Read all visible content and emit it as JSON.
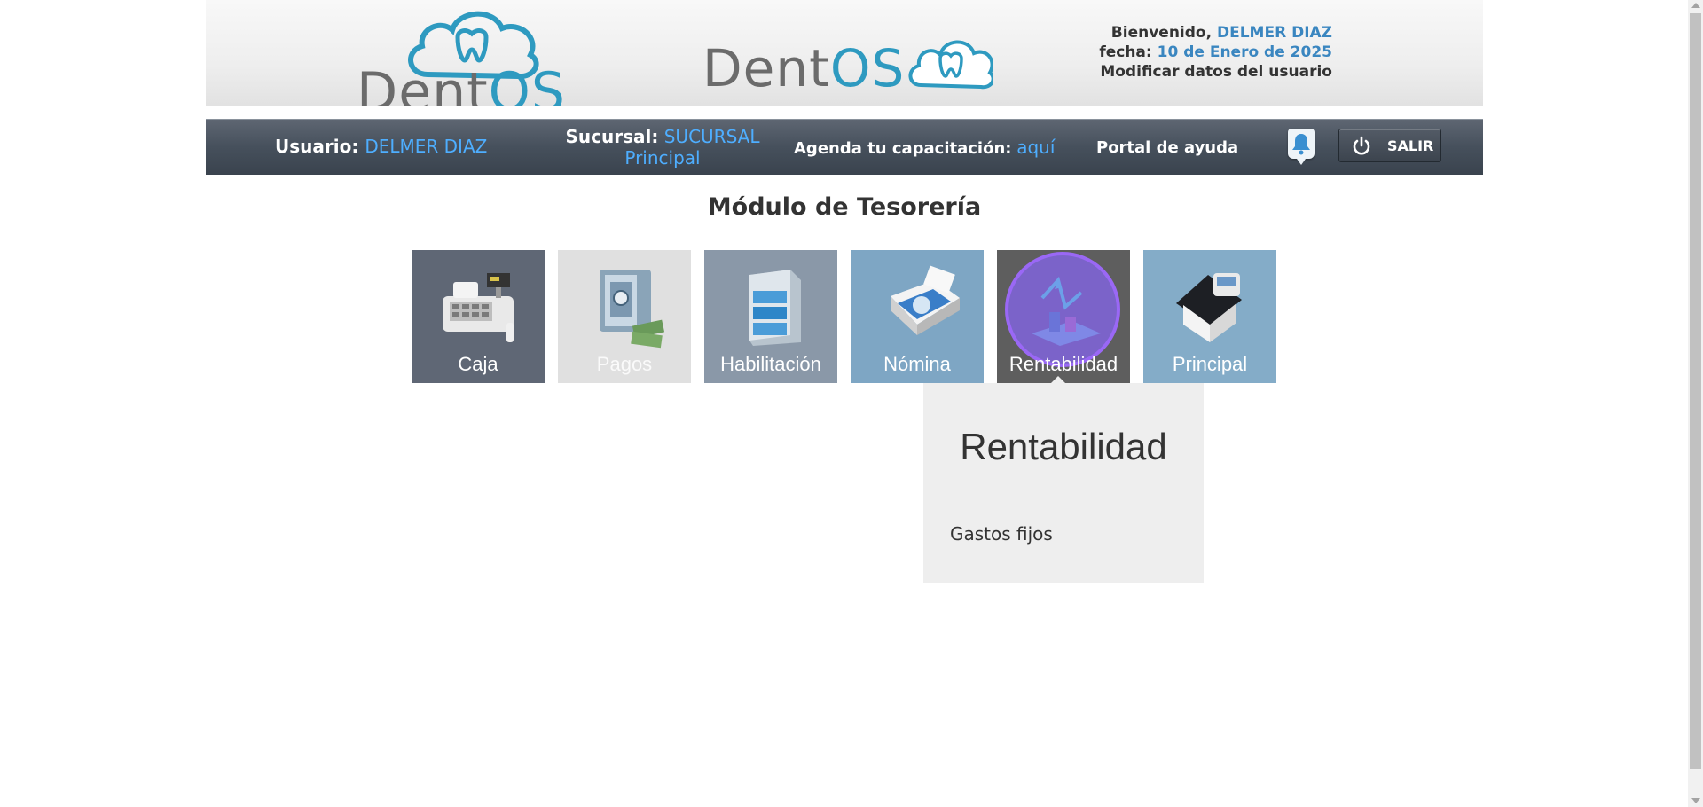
{
  "header": {
    "logo_left": {
      "text_dent": "Dent",
      "text_os": "OS"
    },
    "logo_mid": {
      "text_dent": "Dent",
      "text_os": "OS"
    },
    "welcome_label": "Bienvenido,",
    "user_name": "DELMER DIAZ",
    "date_label": "fecha:",
    "date_value": "10 de Enero de 2025",
    "modify_user_link": "Modificar datos del usuario"
  },
  "navbar": {
    "usuario_label": "Usuario:",
    "usuario_value": "DELMER DIAZ",
    "sucursal_label": "Sucursal:",
    "sucursal_value_line1": "SUCURSAL",
    "sucursal_value_line2": "Principal",
    "agenda_label": "Agenda tu capacitación:",
    "agenda_link": "aquí",
    "portal_link": "Portal de ayuda",
    "bell_icon": "bell-icon",
    "salir_label": "SALIR",
    "salir_icon": "power-icon"
  },
  "main": {
    "title": "Módulo de Tesorería",
    "tiles": [
      {
        "label": "Caja",
        "icon": "cash-register-icon"
      },
      {
        "label": "Pagos",
        "icon": "safe-money-icon"
      },
      {
        "label": "Habilitación",
        "icon": "file-cabinet-icon"
      },
      {
        "label": "Nómina",
        "icon": "printer-icon"
      },
      {
        "label": "Rentabilidad",
        "icon": "growth-chart-icon"
      },
      {
        "label": "Principal",
        "icon": "home-icon"
      }
    ]
  },
  "dropdown": {
    "title": "Rentabilidad",
    "items": [
      "Gastos fijos"
    ]
  },
  "colors": {
    "accent_blue": "#3a86c0",
    "nav_link_blue": "#4eaeff",
    "highlight_purple": "#9a68f5"
  }
}
